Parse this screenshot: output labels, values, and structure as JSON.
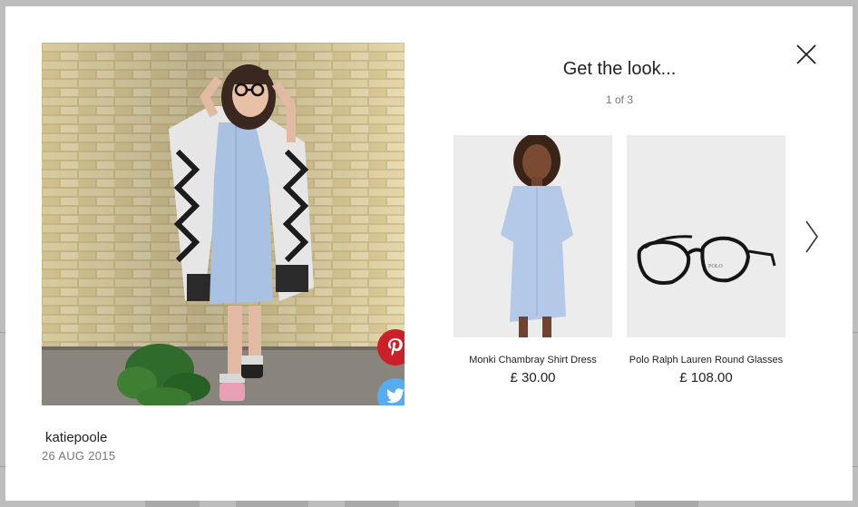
{
  "modal": {
    "title": "Get the look...",
    "pager": "1 of 3",
    "close_icon": "close-icon",
    "next_icon": "chevron-right-icon"
  },
  "post": {
    "username": "katiepoole",
    "date": "26 AUG 2015",
    "share": {
      "pinterest_icon": "pinterest-icon",
      "twitter_icon": "twitter-icon"
    }
  },
  "products": [
    {
      "name": "Monki Chambray Shirt Dress",
      "price": "£ 30.00"
    },
    {
      "name": "Polo Ralph Lauren Round Glasses",
      "price": "£ 108.00",
      "brand_mark": "POLO"
    }
  ],
  "colors": {
    "pinterest": "#cb2027",
    "twitter": "#55acee",
    "overlay": "#bdbdbd"
  }
}
